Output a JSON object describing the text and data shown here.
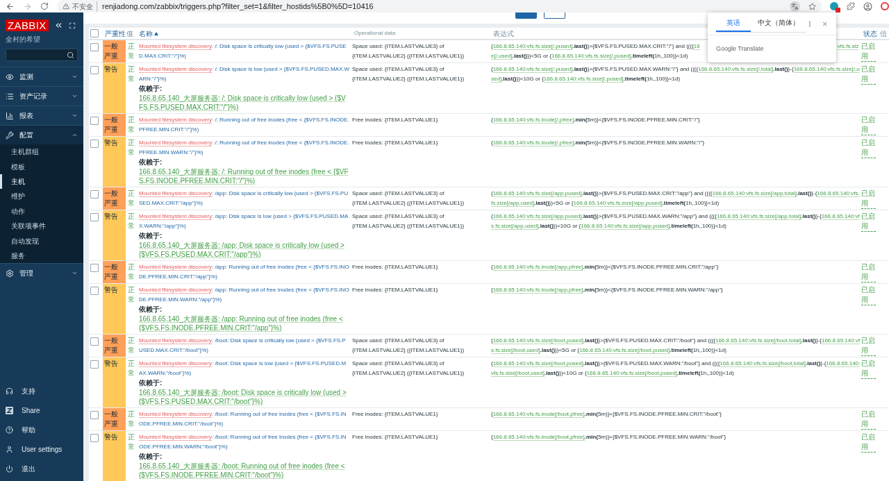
{
  "browser": {
    "security": "不安全",
    "url": "renjiadong.com/zabbix/triggers.php?filter_set=1&filter_hostids%5B0%5D=10416"
  },
  "translate_popup": {
    "tabs": [
      {
        "label": "英语",
        "selected": true
      },
      {
        "label": "中文（简体）",
        "selected": false
      }
    ],
    "footer": "Google Translate"
  },
  "sidebar": {
    "logo": "ZABBIX",
    "subtitle": "全村的希望",
    "menu": [
      {
        "label": "监测",
        "expanded": false,
        "selected": false
      },
      {
        "label": "资产记录",
        "expanded": false,
        "selected": false
      },
      {
        "label": "报表",
        "expanded": false,
        "selected": false
      },
      {
        "label": "配置",
        "expanded": true,
        "selected": true,
        "children": [
          {
            "label": "主机群组",
            "selected": false
          },
          {
            "label": "模板",
            "selected": false
          },
          {
            "label": "主机",
            "selected": true
          },
          {
            "label": "维护",
            "selected": false
          },
          {
            "label": "动作",
            "selected": false
          },
          {
            "label": "关联项事件",
            "selected": false
          },
          {
            "label": "自动发现",
            "selected": false
          },
          {
            "label": "服务",
            "selected": false
          }
        ]
      },
      {
        "label": "管理",
        "expanded": false,
        "selected": false
      }
    ],
    "footer": [
      {
        "label": "支持"
      },
      {
        "label": "Share"
      },
      {
        "label": "帮助"
      },
      {
        "label": "User settings"
      },
      {
        "label": "退出"
      }
    ]
  },
  "table": {
    "select_all_checked": false,
    "columns": [
      {
        "label": "严重性",
        "sortable": true,
        "sorted": false
      },
      {
        "label": "值",
        "sortable": false,
        "sorted": false
      },
      {
        "label": "名称",
        "sortable": true,
        "sorted": true
      },
      {
        "label": "Operational data",
        "sortable": false,
        "sorted": false
      },
      {
        "label": "表达式",
        "sortable": false,
        "sorted": false
      },
      {
        "label": "状态",
        "sortable": true,
        "sorted": false
      },
      {
        "label": "信",
        "sortable": false,
        "sorted": false
      }
    ],
    "rows": [
      {
        "checked": false,
        "severity": {
          "label": "一般严重",
          "kind": "average"
        },
        "value": {
          "text": "正常",
          "ok": true
        },
        "discovery": "Mounted filesystem discovery",
        "name": ": /: Disk space is critically low (used > {$VFS.FS.PUSED.MAX.CRIT:\"/\"}%)",
        "operational_data": "Space used: {ITEM.LASTVALUE3} of {ITEM.LASTVALUE2} ({ITEM.LASTVALUE1})",
        "expression": [
          {
            "kind": "text",
            "text": "{"
          },
          {
            "kind": "item",
            "text": "166.8.65.140:vfs.fs.size[/,pused]"
          },
          {
            "kind": "func",
            "text": ".last()"
          },
          {
            "kind": "text",
            "text": "}>{$VFS.FS.PUSED.MAX.CRIT:\"/\"} and ((({"
          },
          {
            "kind": "item",
            "text": "16"
          },
          {
            "kind": "gap"
          },
          {
            "kind": "item",
            "text": "vfs.fs.size[/,used]"
          },
          {
            "kind": "func",
            "text": ".last()"
          },
          {
            "kind": "text",
            "text": "})<5G or {"
          },
          {
            "kind": "item",
            "text": "166.8.65.140:vfs.fs.size[/,pused]"
          },
          {
            "kind": "func",
            "text": ".timeleft("
          },
          {
            "kind": "text",
            "text": "1h,,100)}<1d)"
          }
        ],
        "status": {
          "text": "已启用",
          "enabled": true
        }
      },
      {
        "checked": false,
        "severity": {
          "label": "警告",
          "kind": "warning"
        },
        "value": {
          "text": "正常",
          "ok": true
        },
        "discovery": "Mounted filesystem discovery",
        "name": ": /: Disk space is low (used > {$VFS.FS.PUSED.MAX.WARN:\"/\"}%)",
        "depends_label": "依赖于:",
        "depends": "166.8.65.140_大屏服务器: /: Disk space is critically low (used > {$VFS.FS.PUSED.MAX.CRIT:\"/\"}%)",
        "operational_data": "Space used: {ITEM.LASTVALUE3} of {ITEM.LASTVALUE2} ({ITEM.LASTVALUE1})",
        "expression": [
          {
            "kind": "text",
            "text": "{"
          },
          {
            "kind": "item",
            "text": "166.8.65.140:vfs.fs.size[/,pused]"
          },
          {
            "kind": "func",
            "text": ".last()"
          },
          {
            "kind": "text",
            "text": "}>{$VFS.FS.PUSED.MAX.WARN:\"/\"} and ((({"
          },
          {
            "kind": "item",
            "text": "166.8.65.140:vfs.fs.size[/,total]"
          },
          {
            "kind": "func",
            "text": ".last()"
          },
          {
            "kind": "text",
            "text": "}-{"
          },
          {
            "kind": "item",
            "text": "166.8.65.140:vfs.fs.size[/,used]"
          },
          {
            "kind": "func",
            "text": ".last()"
          },
          {
            "kind": "text",
            "text": "})<10G or {"
          },
          {
            "kind": "item",
            "text": "166.8.65.140:vfs.fs.size[/,pused]"
          },
          {
            "kind": "func",
            "text": ".timeleft("
          },
          {
            "kind": "text",
            "text": "1h,,100)}<1d)"
          }
        ],
        "status": {
          "text": "已启用",
          "enabled": true
        }
      },
      {
        "checked": false,
        "severity": {
          "label": "一般严重",
          "kind": "average"
        },
        "value": {
          "text": "正常",
          "ok": true
        },
        "discovery": "Mounted filesystem discovery",
        "name": ": /: Running out of free inodes (free < {$VFS.FS.INODE.PFREE.MIN.CRIT:\"/\"}%)",
        "operational_data": "Free inodes: {ITEM.LASTVALUE1}",
        "expression": [
          {
            "kind": "text",
            "text": "{"
          },
          {
            "kind": "item",
            "text": "166.8.65.140:vfs.fs.inode[/,pfree]"
          },
          {
            "kind": "func",
            "text": ".min("
          },
          {
            "kind": "text",
            "text": "5m)}<{$VFS.FS.INODE.PFREE.MIN.CRIT:\"/\"}"
          }
        ],
        "status": {
          "text": "已启用",
          "enabled": true
        }
      },
      {
        "checked": false,
        "severity": {
          "label": "警告",
          "kind": "warning"
        },
        "value": {
          "text": "正常",
          "ok": true
        },
        "discovery": "Mounted filesystem discovery",
        "name": ": /: Running out of free inodes (free < {$VFS.FS.INODE.PFREE.MIN.WARN:\"/\"}%)",
        "depends_label": "依赖于:",
        "depends": "166.8.65.140_大屏服务器: /: Running out of free inodes (free < {$VFS.FS.INODE.PFREE.MIN.CRIT:\"/\"}%)",
        "operational_data": "Free inodes: {ITEM.LASTVALUE1}",
        "expression": [
          {
            "kind": "text",
            "text": "{"
          },
          {
            "kind": "item",
            "text": "166.8.65.140:vfs.fs.inode[/,pfree]"
          },
          {
            "kind": "func",
            "text": ".min("
          },
          {
            "kind": "text",
            "text": "5m)}<{$VFS.FS.INODE.PFREE.MIN.WARN:\"/\"}"
          }
        ],
        "status": {
          "text": "已启用",
          "enabled": true
        }
      },
      {
        "checked": false,
        "severity": {
          "label": "一般严重",
          "kind": "average"
        },
        "value": {
          "text": "正常",
          "ok": true
        },
        "discovery": "Mounted filesystem discovery",
        "name": ": /app: Disk space is critically low (used > {$VFS.FS.PUSED.MAX.CRIT:\"/app\"}%)",
        "operational_data": "Space used: {ITEM.LASTVALUE3} of {ITEM.LASTVALUE2} ({ITEM.LASTVALUE1})",
        "expression": [
          {
            "kind": "text",
            "text": "{"
          },
          {
            "kind": "item",
            "text": "166.8.65.140:vfs.fs.size[/app,pused]"
          },
          {
            "kind": "func",
            "text": ".last()"
          },
          {
            "kind": "text",
            "text": "}>{$VFS.FS.PUSED.MAX.CRIT:\"/app\"} and ((({"
          },
          {
            "kind": "item",
            "text": "166.8.65.140:vfs.fs.size[/app,total]"
          },
          {
            "kind": "func",
            "text": ".last()"
          },
          {
            "kind": "text",
            "text": "}-{"
          },
          {
            "kind": "item",
            "text": "166.8.65.140:vfs.fs.size[/app,used]"
          },
          {
            "kind": "func",
            "text": ".last()"
          },
          {
            "kind": "text",
            "text": "})<5G or {"
          },
          {
            "kind": "item",
            "text": "166.8.65.140:vfs.fs.size[/app,pused]"
          },
          {
            "kind": "func",
            "text": ".timeleft("
          },
          {
            "kind": "text",
            "text": "1h,,100)}<1d)"
          }
        ],
        "status": {
          "text": "已启用",
          "enabled": true
        }
      },
      {
        "checked": false,
        "severity": {
          "label": "警告",
          "kind": "warning"
        },
        "value": {
          "text": "正常",
          "ok": true
        },
        "discovery": "Mounted filesystem discovery",
        "name": ": /app: Disk space is low (used > {$VFS.FS.PUSED.MAX.WARN:\"/app\"}%)",
        "depends_label": "依赖于:",
        "depends": "166.8.65.140_大屏服务器: /app: Disk space is critically low (used > {$VFS.FS.PUSED.MAX.CRIT:\"/app\"}%)",
        "operational_data": "Space used: {ITEM.LASTVALUE3} of {ITEM.LASTVALUE2} ({ITEM.LASTVALUE1})",
        "expression": [
          {
            "kind": "text",
            "text": "{"
          },
          {
            "kind": "item",
            "text": "166.8.65.140:vfs.fs.size[/app,pused]"
          },
          {
            "kind": "func",
            "text": ".last()"
          },
          {
            "kind": "text",
            "text": "}>{$VFS.FS.PUSED.MAX.WARN:\"/app\"} and ((({"
          },
          {
            "kind": "item",
            "text": "166.8.65.140:vfs.fs.size[/app,total]"
          },
          {
            "kind": "func",
            "text": ".last()"
          },
          {
            "kind": "text",
            "text": "}-{"
          },
          {
            "kind": "item",
            "text": "166.8.65.140:vfs.fs.size[/app,used]"
          },
          {
            "kind": "func",
            "text": ".last()"
          },
          {
            "kind": "text",
            "text": "})<10G or {"
          },
          {
            "kind": "item",
            "text": "166.8.65.140:vfs.fs.size[/app,pused]"
          },
          {
            "kind": "func",
            "text": ".timeleft("
          },
          {
            "kind": "text",
            "text": "1h,,100)}<1d)"
          }
        ],
        "status": {
          "text": "已启用",
          "enabled": true
        }
      },
      {
        "checked": false,
        "severity": {
          "label": "一般严重",
          "kind": "average"
        },
        "value": {
          "text": "正常",
          "ok": true
        },
        "discovery": "Mounted filesystem discovery",
        "name": ": /app: Running out of free inodes (free < {$VFS.FS.INODE.PFREE.MIN.CRIT:\"/app\"}%)",
        "operational_data": "Free inodes: {ITEM.LASTVALUE1}",
        "expression": [
          {
            "kind": "text",
            "text": "{"
          },
          {
            "kind": "item",
            "text": "166.8.65.140:vfs.fs.inode[/app,pfree]"
          },
          {
            "kind": "func",
            "text": ".min("
          },
          {
            "kind": "text",
            "text": "5m)}<{$VFS.FS.INODE.PFREE.MIN.CRIT:\"/app\"}"
          }
        ],
        "status": {
          "text": "已启用",
          "enabled": true
        }
      },
      {
        "checked": false,
        "severity": {
          "label": "警告",
          "kind": "warning"
        },
        "value": {
          "text": "正常",
          "ok": true
        },
        "discovery": "Mounted filesystem discovery",
        "name": ": /app: Running out of free inodes (free < {$VFS.FS.INODE.PFREE.MIN.WARN:\"/app\"}%)",
        "depends_label": "依赖于:",
        "depends": "166.8.65.140_大屏服务器: /app: Running out of free inodes (free < {$VFS.FS.INODE.PFREE.MIN.CRIT:\"/app\"}%)",
        "operational_data": "Free inodes: {ITEM.LASTVALUE1}",
        "expression": [
          {
            "kind": "text",
            "text": "{"
          },
          {
            "kind": "item",
            "text": "166.8.65.140:vfs.fs.inode[/app,pfree]"
          },
          {
            "kind": "func",
            "text": ".min("
          },
          {
            "kind": "text",
            "text": "5m)}<{$VFS.FS.INODE.PFREE.MIN.WARN:\"/app\"}"
          }
        ],
        "status": {
          "text": "已启用",
          "enabled": true
        }
      },
      {
        "checked": false,
        "severity": {
          "label": "一般严重",
          "kind": "average"
        },
        "value": {
          "text": "正常",
          "ok": true
        },
        "discovery": "Mounted filesystem discovery",
        "name": ": /boot: Disk space is critically low (used > {$VFS.FS.PUSED.MAX.CRIT:\"/boot\"}%)",
        "operational_data": "Space used: {ITEM.LASTVALUE3} of {ITEM.LASTVALUE2} ({ITEM.LASTVALUE1})",
        "expression": [
          {
            "kind": "text",
            "text": "{"
          },
          {
            "kind": "item",
            "text": "166.8.65.140:vfs.fs.size[/boot,pused]"
          },
          {
            "kind": "func",
            "text": ".last()"
          },
          {
            "kind": "text",
            "text": "}>{$VFS.FS.PUSED.MAX.CRIT:\"/boot\"} and ((({"
          },
          {
            "kind": "item",
            "text": "166.8.65.140:vfs.fs.size[/boot,total]"
          },
          {
            "kind": "func",
            "text": ".last()"
          },
          {
            "kind": "text",
            "text": "}-{"
          },
          {
            "kind": "item",
            "text": "166.8.65.140:vfs.fs.size[/boot,used]"
          },
          {
            "kind": "func",
            "text": ".last()"
          },
          {
            "kind": "text",
            "text": "})<5G or {"
          },
          {
            "kind": "item",
            "text": "166.8.65.140:vfs.fs.size[/boot,pused]"
          },
          {
            "kind": "func",
            "text": ".timeleft("
          },
          {
            "kind": "text",
            "text": "1h,,100)}<1d)"
          }
        ],
        "status": {
          "text": "已启用",
          "enabled": true
        }
      },
      {
        "checked": false,
        "severity": {
          "label": "警告",
          "kind": "warning"
        },
        "value": {
          "text": "正常",
          "ok": true
        },
        "discovery": "Mounted filesystem discovery",
        "name": ": /boot: Disk space is low (used > {$VFS.FS.PUSED.MAX.WARN:\"/boot\"}%)",
        "depends_label": "依赖于:",
        "depends": "166.8.65.140_大屏服务器: /boot: Disk space is critically low (used > {$VFS.FS.PUSED.MAX.CRIT:\"/boot\"}%)",
        "operational_data": "Space used: {ITEM.LASTVALUE3} of {ITEM.LASTVALUE2} ({ITEM.LASTVALUE1})",
        "expression": [
          {
            "kind": "text",
            "text": "{"
          },
          {
            "kind": "item",
            "text": "166.8.65.140:vfs.fs.size[/boot,pused]"
          },
          {
            "kind": "func",
            "text": ".last()"
          },
          {
            "kind": "text",
            "text": "}>{$VFS.FS.PUSED.MAX.WARN:\"/boot\"} and ((({"
          },
          {
            "kind": "item",
            "text": "166.8.65.140:vfs.fs.size[/boot,total]"
          },
          {
            "kind": "func",
            "text": ".last()"
          },
          {
            "kind": "text",
            "text": "}-{"
          },
          {
            "kind": "item",
            "text": "166.8.65.140:vfs.fs.size[/boot,used]"
          },
          {
            "kind": "func",
            "text": ".last()"
          },
          {
            "kind": "text",
            "text": "})<10G or {"
          },
          {
            "kind": "item",
            "text": "166.8.65.140:vfs.fs.size[/boot,pused]"
          },
          {
            "kind": "func",
            "text": ".timeleft("
          },
          {
            "kind": "text",
            "text": "1h,,100)}<1d)"
          }
        ],
        "status": {
          "text": "已启用",
          "enabled": true
        }
      },
      {
        "checked": false,
        "severity": {
          "label": "一般严重",
          "kind": "average"
        },
        "value": {
          "text": "正常",
          "ok": true
        },
        "discovery": "Mounted filesystem discovery",
        "name": ": /boot: Running out of free inodes (free < {$VFS.FS.INODE.PFREE.MIN.CRIT:\"/boot\"}%)",
        "operational_data": "Free inodes: {ITEM.LASTVALUE1}",
        "expression": [
          {
            "kind": "text",
            "text": "{"
          },
          {
            "kind": "item",
            "text": "166.8.65.140:vfs.fs.inode[/boot,pfree]"
          },
          {
            "kind": "func",
            "text": ".min("
          },
          {
            "kind": "text",
            "text": "5m)}<{$VFS.FS.INODE.PFREE.MIN.CRIT:\"/boot\"}"
          }
        ],
        "status": {
          "text": "已启用",
          "enabled": true
        }
      },
      {
        "checked": false,
        "severity": {
          "label": "警告",
          "kind": "warning"
        },
        "value": {
          "text": "正常",
          "ok": true
        },
        "discovery": "Mounted filesystem discovery",
        "name": ": /boot: Running out of free inodes (free < {$VFS.FS.INODE.PFREE.MIN.WARN:\"/boot\"}%)",
        "depends_label": "依赖于:",
        "depends": "166.8.65.140_大屏服务器: /boot: Running out of free inodes (free < {$VFS.FS.INODE.PFREE.MIN.CRIT:\"/boot\"}%)",
        "operational_data": "Free inodes: {ITEM.LASTVALUE1}",
        "expression": [
          {
            "kind": "text",
            "text": "{"
          },
          {
            "kind": "item",
            "text": "166.8.65.140:vfs.fs.inode[/boot,pfree]"
          },
          {
            "kind": "func",
            "text": ".min("
          },
          {
            "kind": "text",
            "text": "5m)}<{$VFS.FS.INODE.PFREE.MIN.WARN:\"/boot\"}"
          }
        ],
        "status": {
          "text": "已启用",
          "enabled": true
        }
      }
    ]
  }
}
